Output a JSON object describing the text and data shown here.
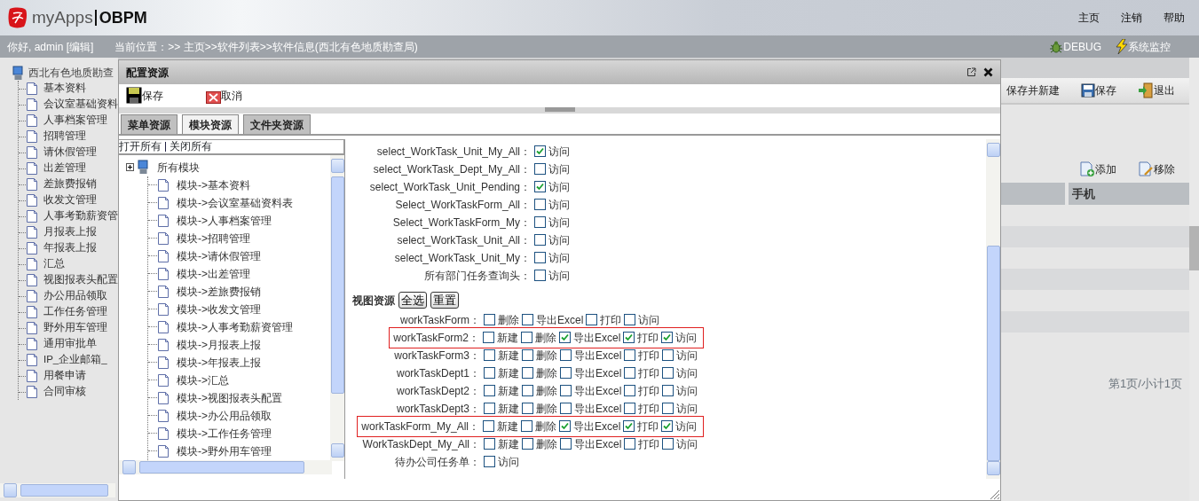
{
  "header": {
    "brand": "myApps",
    "product": "OBPM",
    "links": [
      "主页",
      "注销",
      "帮助"
    ]
  },
  "nav": {
    "greeting": "你好, admin [编辑]",
    "location": "当前位置：>> 主页>>软件列表>>软件信息(西北有色地质勘查局)",
    "tools": [
      {
        "label": "DEBUG",
        "kind": "debug"
      },
      {
        "label": "系统监控",
        "kind": "monitor"
      }
    ]
  },
  "sidebar": {
    "root": "西北有色地质勘查",
    "items": [
      "基本资料",
      "会议室基础资料",
      "人事档案管理",
      "招聘管理",
      "请休假管理",
      "出差管理",
      "差旅费报销",
      "收发文管理",
      "人事考勤薪资管",
      "月报表上报",
      "年报表上报",
      "汇总",
      "视图报表头配置",
      "办公用品领取",
      "工作任务管理",
      "野外用车管理",
      "通用审批单",
      "IP_企业邮箱_",
      "用餐申请",
      "合同审核"
    ]
  },
  "background": {
    "toolbar": [
      {
        "label": "保存并新建",
        "kind": "plain"
      },
      {
        "label": "保存",
        "kind": "save"
      },
      {
        "label": "退出",
        "kind": "exit"
      }
    ],
    "actions": [
      {
        "label": "添加",
        "kind": "add"
      },
      {
        "label": "移除",
        "kind": "remove"
      }
    ],
    "table": {
      "columns": [
        {
          "kind": "blank"
        },
        {
          "kind": "text",
          "label": "手机"
        }
      ]
    },
    "pager": "第1页/小计1页"
  },
  "dialog": {
    "title": "配置资源",
    "toolbar": [
      {
        "label": "保存",
        "kind": "save"
      },
      {
        "label": "取消",
        "kind": "cancel"
      }
    ],
    "tabs": [
      {
        "label": "菜单资源",
        "selected": false
      },
      {
        "label": "模块资源",
        "selected": true
      },
      {
        "label": "文件夹资源",
        "selected": false
      }
    ],
    "tree": {
      "links": [
        "打开所有",
        "关闭所有"
      ],
      "root": "所有模块",
      "children": [
        "模块->基本资料",
        "模块->会议室基础资料表",
        "模块->人事档案管理",
        "模块->招聘管理",
        "模块->请休假管理",
        "模块->出差管理",
        "模块->差旅费报销",
        "模块->收发文管理",
        "模块->人事考勤薪资管理",
        "模块->月报表上报",
        "模块->年报表上报",
        "模块->汇总",
        "模块->视图报表头配置",
        "模块->办公用品领取",
        "模块->工作任务管理",
        "模块->野外用车管理"
      ]
    },
    "resources": [
      {
        "name": "select_WorkTask_Unit_My_All：",
        "permissions": [
          {
            "label": "访问",
            "checked": true
          }
        ]
      },
      {
        "name": "select_WorkTask_Dept_My_All：",
        "permissions": [
          {
            "label": "访问",
            "checked": false
          }
        ]
      },
      {
        "name": "select_WorkTask_Unit_Pending：",
        "permissions": [
          {
            "label": "访问",
            "checked": true
          }
        ]
      },
      {
        "name": "Select_WorkTaskForm_All：",
        "permissions": [
          {
            "label": "访问",
            "checked": false
          }
        ]
      },
      {
        "name": "Select_WorkTaskForm_My：",
        "permissions": [
          {
            "label": "访问",
            "checked": false
          }
        ]
      },
      {
        "name": "select_WorkTask_Unit_All：",
        "permissions": [
          {
            "label": "访问",
            "checked": false
          }
        ]
      },
      {
        "name": "select_WorkTask_Unit_My：",
        "permissions": [
          {
            "label": "访问",
            "checked": false
          }
        ]
      },
      {
        "name": "所有部门任务查询头：",
        "permissions": [
          {
            "label": "访问",
            "checked": false
          }
        ]
      }
    ],
    "view_section": {
      "title": "视图资源",
      "buttons": [
        "全选",
        "重置"
      ],
      "rows": [
        {
          "name": "workTaskForm：",
          "highlighted": false,
          "permissions": [
            {
              "label": "删除",
              "checked": false
            },
            {
              "label": "导出Excel",
              "checked": false
            },
            {
              "label": "打印",
              "checked": false
            },
            {
              "label": "访问",
              "checked": false
            }
          ]
        },
        {
          "name": "workTaskForm2：",
          "highlighted": true,
          "permissions": [
            {
              "label": "新建",
              "checked": false
            },
            {
              "label": "删除",
              "checked": false
            },
            {
              "label": "导出Excel",
              "checked": true
            },
            {
              "label": "打印",
              "checked": true
            },
            {
              "label": "访问",
              "checked": true
            }
          ]
        },
        {
          "name": "workTaskForm3：",
          "highlighted": false,
          "permissions": [
            {
              "label": "新建",
              "checked": false
            },
            {
              "label": "删除",
              "checked": false
            },
            {
              "label": "导出Excel",
              "checked": false
            },
            {
              "label": "打印",
              "checked": false
            },
            {
              "label": "访问",
              "checked": false
            }
          ]
        },
        {
          "name": "workTaskDept1：",
          "highlighted": false,
          "permissions": [
            {
              "label": "新建",
              "checked": false
            },
            {
              "label": "删除",
              "checked": false
            },
            {
              "label": "导出Excel",
              "checked": false
            },
            {
              "label": "打印",
              "checked": false
            },
            {
              "label": "访问",
              "checked": false
            }
          ]
        },
        {
          "name": "workTaskDept2：",
          "highlighted": false,
          "permissions": [
            {
              "label": "新建",
              "checked": false
            },
            {
              "label": "删除",
              "checked": false
            },
            {
              "label": "导出Excel",
              "checked": false
            },
            {
              "label": "打印",
              "checked": false
            },
            {
              "label": "访问",
              "checked": false
            }
          ]
        },
        {
          "name": "workTaskDept3：",
          "highlighted": false,
          "permissions": [
            {
              "label": "新建",
              "checked": false
            },
            {
              "label": "删除",
              "checked": false
            },
            {
              "label": "导出Excel",
              "checked": false
            },
            {
              "label": "打印",
              "checked": false
            },
            {
              "label": "访问",
              "checked": false
            }
          ]
        },
        {
          "name": "workTaskForm_My_All：",
          "highlighted": true,
          "permissions": [
            {
              "label": "新建",
              "checked": false
            },
            {
              "label": "删除",
              "checked": false
            },
            {
              "label": "导出Excel",
              "checked": true
            },
            {
              "label": "打印",
              "checked": true
            },
            {
              "label": "访问",
              "checked": true
            }
          ]
        },
        {
          "name": "WorkTaskDept_My_All：",
          "highlighted": false,
          "permissions": [
            {
              "label": "新建",
              "checked": false
            },
            {
              "label": "删除",
              "checked": false
            },
            {
              "label": "导出Excel",
              "checked": false
            },
            {
              "label": "打印",
              "checked": false
            },
            {
              "label": "访问",
              "checked": false
            }
          ]
        },
        {
          "name": "待办公司任务单：",
          "highlighted": false,
          "permissions": [
            {
              "label": "访问",
              "checked": false
            }
          ]
        }
      ]
    }
  }
}
